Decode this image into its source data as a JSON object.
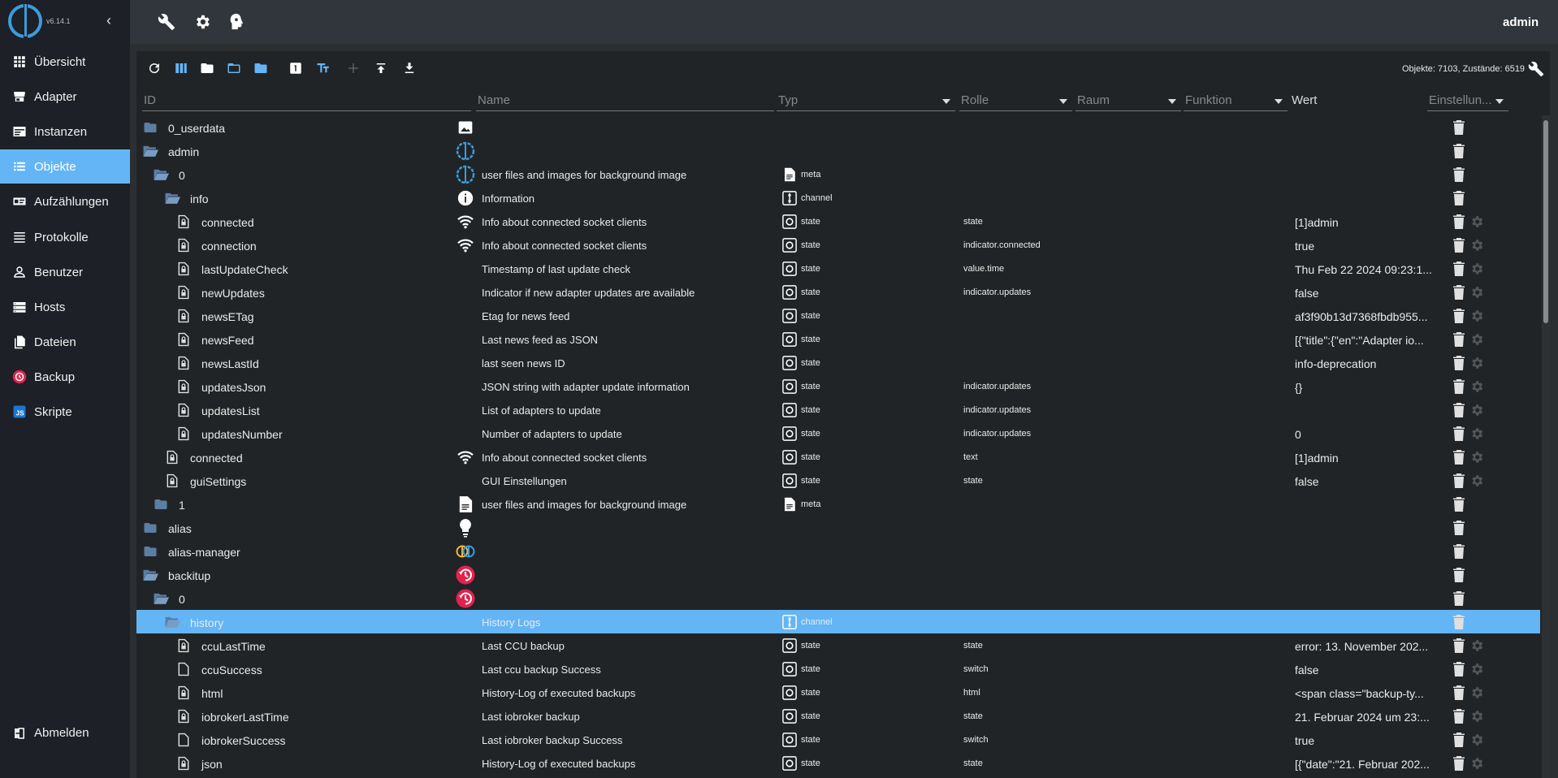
{
  "app": {
    "version": "v6.14.1",
    "user": "admin"
  },
  "sidebar": {
    "items": [
      {
        "label": "Übersicht",
        "icon": "grid-icon"
      },
      {
        "label": "Adapter",
        "icon": "store-icon"
      },
      {
        "label": "Instanzen",
        "icon": "instances-icon"
      },
      {
        "label": "Objekte",
        "icon": "list-icon",
        "active": true
      },
      {
        "label": "Aufzählungen",
        "icon": "enum-icon"
      },
      {
        "label": "Protokolle",
        "icon": "log-icon"
      },
      {
        "label": "Benutzer",
        "icon": "user-icon"
      },
      {
        "label": "Hosts",
        "icon": "hosts-icon"
      },
      {
        "label": "Dateien",
        "icon": "files-icon"
      },
      {
        "label": "Backup",
        "icon": "backup-icon"
      },
      {
        "label": "Skripte",
        "icon": "js-icon"
      }
    ],
    "logout_label": "Abmelden"
  },
  "toolbar": {
    "object_count": "Objekte: 7103, Zustände: 6519"
  },
  "columns": {
    "id": "ID",
    "name": "Name",
    "type": "Typ",
    "role": "Rolle",
    "room": "Raum",
    "function": "Funktion",
    "value": "Wert",
    "settings": "Einstellun..."
  },
  "colors": {
    "accent": "#64b5f6",
    "sidebar": "#1d2026",
    "panel": "#212426",
    "backitup": "#e0234e"
  },
  "rows": [
    {
      "id": "0_userdata",
      "icon": "folder",
      "indent": 0,
      "nicon": "image",
      "name": "",
      "type": "",
      "role": "",
      "value": "",
      "gear": false
    },
    {
      "id": "admin",
      "icon": "folder-open",
      "indent": 0,
      "nicon": "iobroker",
      "name": "",
      "type": "",
      "role": "",
      "value": "",
      "gear": false
    },
    {
      "id": "0",
      "icon": "folder-open",
      "indent": 1,
      "nicon": "iobroker",
      "name": "user files and images for background image",
      "type": "meta",
      "tchip": "file",
      "role": "",
      "value": "",
      "gear": false
    },
    {
      "id": "info",
      "icon": "folder-open",
      "indent": 2,
      "nicon": "info",
      "name": "Information",
      "type": "channel",
      "tchip": "channel",
      "role": "",
      "value": "",
      "gear": false
    },
    {
      "id": "connected",
      "icon": "file",
      "indent": 3,
      "nicon": "wifi",
      "name": "Info about connected socket clients",
      "type": "state",
      "tchip": "state",
      "role": "state",
      "value": "[1]admin",
      "gear": true
    },
    {
      "id": "connection",
      "icon": "file",
      "indent": 3,
      "nicon": "wifi",
      "name": "Info about connected socket clients",
      "type": "state",
      "tchip": "state",
      "role": "indicator.connected",
      "value": "true",
      "gear": true
    },
    {
      "id": "lastUpdateCheck",
      "icon": "file",
      "indent": 3,
      "nicon": "",
      "name": "Timestamp of last update check",
      "type": "state",
      "tchip": "state",
      "role": "value.time",
      "value": "Thu Feb 22 2024 09:23:1...",
      "gear": true
    },
    {
      "id": "newUpdates",
      "icon": "file",
      "indent": 3,
      "nicon": "",
      "name": "Indicator if new adapter updates are available",
      "type": "state",
      "tchip": "state",
      "role": "indicator.updates",
      "value": "false",
      "gear": true
    },
    {
      "id": "newsETag",
      "icon": "file",
      "indent": 3,
      "nicon": "",
      "name": "Etag for news feed",
      "type": "state",
      "tchip": "state",
      "role": "",
      "value": "af3f90b13d7368fbdb955...",
      "gear": true
    },
    {
      "id": "newsFeed",
      "icon": "file",
      "indent": 3,
      "nicon": "",
      "name": "Last news feed as JSON",
      "type": "state",
      "tchip": "state",
      "role": "",
      "value": "[{\"title\":{\"en\":\"Adapter io...",
      "gear": true
    },
    {
      "id": "newsLastId",
      "icon": "file",
      "indent": 3,
      "nicon": "",
      "name": "last seen news ID",
      "type": "state",
      "tchip": "state",
      "role": "",
      "value": "info-deprecation",
      "gear": true
    },
    {
      "id": "updatesJson",
      "icon": "file",
      "indent": 3,
      "nicon": "",
      "name": "JSON string with adapter update information",
      "type": "state",
      "tchip": "state",
      "role": "indicator.updates",
      "value": "{}",
      "gear": true
    },
    {
      "id": "updatesList",
      "icon": "file",
      "indent": 3,
      "nicon": "",
      "name": "List of adapters to update",
      "type": "state",
      "tchip": "state",
      "role": "indicator.updates",
      "value": "",
      "gear": true
    },
    {
      "id": "updatesNumber",
      "icon": "file",
      "indent": 3,
      "nicon": "",
      "name": "Number of adapters to update",
      "type": "state",
      "tchip": "state",
      "role": "indicator.updates",
      "value": "0",
      "gear": true
    },
    {
      "id": "connected",
      "icon": "file",
      "indent": 2,
      "nicon": "wifi",
      "name": "Info about connected socket clients",
      "type": "state",
      "tchip": "state",
      "role": "text",
      "value": "[1]admin",
      "gear": true
    },
    {
      "id": "guiSettings",
      "icon": "file",
      "indent": 2,
      "nicon": "",
      "name": "GUI Einstellungen",
      "type": "state",
      "tchip": "state",
      "role": "state",
      "value": "false",
      "gear": true
    },
    {
      "id": "1",
      "icon": "folder",
      "indent": 1,
      "nicon": "doc",
      "name": "user files and images for background image",
      "type": "meta",
      "tchip": "file",
      "role": "",
      "value": "",
      "gear": false
    },
    {
      "id": "alias",
      "icon": "folder",
      "indent": 0,
      "nicon": "bulb",
      "name": "",
      "type": "",
      "role": "",
      "value": "",
      "gear": false
    },
    {
      "id": "alias-manager",
      "icon": "folder",
      "indent": 0,
      "nicon": "aliasmgr",
      "name": "",
      "type": "",
      "role": "",
      "value": "",
      "gear": false
    },
    {
      "id": "backitup",
      "icon": "folder-open",
      "indent": 0,
      "nicon": "backitup",
      "name": "",
      "type": "",
      "role": "",
      "value": "",
      "gear": false
    },
    {
      "id": "0",
      "icon": "folder-open",
      "indent": 1,
      "nicon": "backitup",
      "name": "",
      "type": "",
      "role": "",
      "value": "",
      "gear": false
    },
    {
      "id": "history",
      "icon": "folder-open",
      "indent": 2,
      "nicon": "",
      "name": "History Logs",
      "type": "channel",
      "tchip": "channel",
      "role": "",
      "value": "",
      "gear": false,
      "selected": true
    },
    {
      "id": "ccuLastTime",
      "icon": "file",
      "indent": 3,
      "nicon": "",
      "name": "Last CCU backup",
      "type": "state",
      "tchip": "state",
      "role": "state",
      "value": "error: 13. November 202...",
      "gear": true
    },
    {
      "id": "ccuSuccess",
      "icon": "file-plain",
      "indent": 3,
      "nicon": "",
      "name": "Last ccu backup Success",
      "type": "state",
      "tchip": "state",
      "role": "switch",
      "value": "false",
      "gear": true
    },
    {
      "id": "html",
      "icon": "file",
      "indent": 3,
      "nicon": "",
      "name": "History-Log of executed backups",
      "type": "state",
      "tchip": "state",
      "role": "html",
      "value": "<span class=\"backup-ty...",
      "gear": true
    },
    {
      "id": "iobrokerLastTime",
      "icon": "file",
      "indent": 3,
      "nicon": "",
      "name": "Last iobroker backup",
      "type": "state",
      "tchip": "state",
      "role": "state",
      "value": "21. Februar 2024 um 23:...",
      "gear": true
    },
    {
      "id": "iobrokerSuccess",
      "icon": "file-plain",
      "indent": 3,
      "nicon": "",
      "name": "Last iobroker backup Success",
      "type": "state",
      "tchip": "state",
      "role": "switch",
      "value": "true",
      "gear": true
    },
    {
      "id": "json",
      "icon": "file",
      "indent": 3,
      "nicon": "",
      "name": "History-Log of executed backups",
      "type": "state",
      "tchip": "state",
      "role": "state",
      "value": "[{\"date\":\"21. Februar 202...",
      "gear": true
    }
  ]
}
